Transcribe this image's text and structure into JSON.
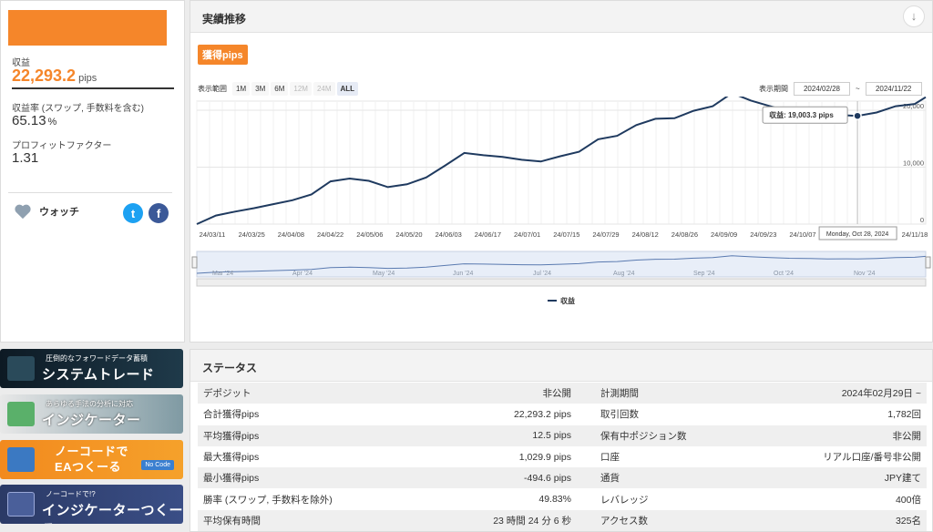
{
  "summary": {
    "profit_label": "収益",
    "profit_value": "22,293.2",
    "profit_unit": "pips",
    "return_label": "収益率 (スワップ, 手数料を含む)",
    "return_value": "65.13",
    "return_unit": "%",
    "pf_label": "プロフィットファクター",
    "pf_value": "1.31",
    "watch_label": "ウォッチ"
  },
  "banners": [
    {
      "small": "圧倒的なフォワードデータ蓄積",
      "big": "システムトレード"
    },
    {
      "small": "あらゆる手法の分析に対応",
      "big": "インジケーター"
    },
    {
      "small": "",
      "big1": "ノーコードで",
      "big2": "EAつくーる",
      "badge": "No Code"
    },
    {
      "small": "ノーコードで!?",
      "big": "インジケーターつくーる"
    }
  ],
  "chart_panel": {
    "title": "実績推移",
    "tag": "獲得pips",
    "range_label": "表示範囲",
    "ranges": [
      "1M",
      "3M",
      "6M",
      "12M",
      "24M",
      "ALL"
    ],
    "period_label": "表示期間",
    "date_from": "2024/02/28",
    "date_sep": "~",
    "date_to": "2024/11/22",
    "tooltip_label": "収益: 19,003.3 pips",
    "crosshair_date": "Monday, Oct 28, 2024",
    "legend": "収益",
    "navigator_months": [
      "Mar '24",
      "Apr '24",
      "May '24",
      "Jun '24",
      "Jul '24",
      "Aug '24",
      "Sep '24",
      "Oct '24",
      "Nov '24"
    ]
  },
  "chart_data": {
    "type": "line",
    "series": [
      {
        "name": "収益",
        "x": [
          "2024-02-29",
          "2024-03-07",
          "2024-03-14",
          "2024-03-21",
          "2024-03-28",
          "2024-04-04",
          "2024-04-11",
          "2024-04-18",
          "2024-04-25",
          "2024-05-02",
          "2024-05-09",
          "2024-05-16",
          "2024-05-23",
          "2024-05-30",
          "2024-06-06",
          "2024-06-13",
          "2024-06-20",
          "2024-06-27",
          "2024-07-04",
          "2024-07-11",
          "2024-07-18",
          "2024-07-25",
          "2024-08-01",
          "2024-08-08",
          "2024-08-15",
          "2024-08-22",
          "2024-08-29",
          "2024-09-05",
          "2024-09-12",
          "2024-09-19",
          "2024-09-26",
          "2024-10-03",
          "2024-10-10",
          "2024-10-17",
          "2024-10-24",
          "2024-10-28",
          "2024-11-04",
          "2024-11-11",
          "2024-11-18",
          "2024-11-22"
        ],
        "values": [
          0,
          1500,
          2200,
          2800,
          3500,
          4200,
          5200,
          7500,
          8000,
          7600,
          6500,
          7000,
          8200,
          10300,
          12500,
          12100,
          11800,
          11300,
          11000,
          11900,
          12700,
          14900,
          15500,
          17400,
          18500,
          18600,
          19900,
          20700,
          23000,
          21700,
          20700,
          19800,
          19600,
          18800,
          19100,
          19003.3,
          19600,
          20700,
          21100,
          22293.2
        ]
      }
    ],
    "x_tick_labels": [
      "24/03/11",
      "24/03/25",
      "24/04/08",
      "24/04/22",
      "24/05/06",
      "24/05/20",
      "24/06/03",
      "24/06/17",
      "24/07/01",
      "24/07/15",
      "24/07/29",
      "24/08/12",
      "24/08/26",
      "24/09/09",
      "24/09/23",
      "24/10/07",
      "24/11/18"
    ],
    "y_ticks": [
      0,
      10000,
      20000
    ],
    "y_tick_labels": [
      "0",
      "10,000",
      "20,000"
    ],
    "ylim": [
      0,
      24000
    ],
    "legend_position": "bottom"
  },
  "status": {
    "title": "ステータス",
    "rows": [
      {
        "l1": "デポジット",
        "v1": "非公開",
        "l2": "計測期間",
        "v2": "2024年02月29日 ~"
      },
      {
        "l1": "合計獲得pips",
        "v1": "22,293.2 pips",
        "l2": "取引回数",
        "v2": "1,782回"
      },
      {
        "l1": "平均獲得pips",
        "v1": "12.5 pips",
        "l2": "保有中ポジション数",
        "v2": "非公開"
      },
      {
        "l1": "最大獲得pips",
        "v1": "1,029.9 pips",
        "l2": "口座",
        "v2": "リアル口座/番号非公開"
      },
      {
        "l1": "最小獲得pips",
        "v1": "-494.6 pips",
        "l2": "通貨",
        "v2": "JPY建て"
      },
      {
        "l1": "勝率 (スワップ, 手数料を除外)",
        "v1": "49.83%",
        "l2": "レバレッジ",
        "v2": "400倍"
      },
      {
        "l1": "平均保有時間",
        "v1": "23 時間 24 分 6 秒",
        "l2": "アクセス数",
        "v2": "325名"
      }
    ]
  },
  "colors": {
    "accent": "#f5862a",
    "line": "#1f3a5f",
    "twitter": "#1da1f2",
    "facebook": "#3b5998"
  }
}
